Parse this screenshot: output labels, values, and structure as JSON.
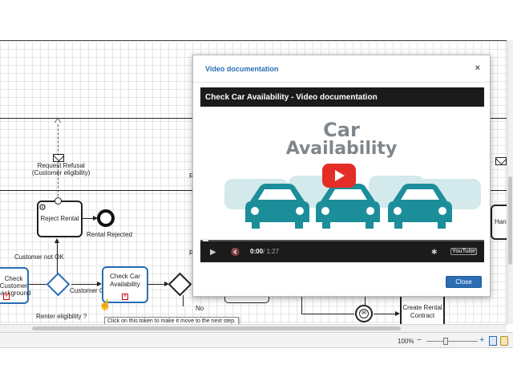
{
  "diagram": {
    "labels": {
      "request_refusal": "Request Refusal\n(Customer eligibility)",
      "reject_rental": "Reject Rental",
      "rental_rejected": "Rental Rejected",
      "customer_not_ok": "Customer not OK",
      "check_customer_background": "Check\nCustomer\nBackground",
      "customer_ok": "Customer OK",
      "check_car_availability": "Check Car\nAvailability",
      "renter_eligibility": "Renter eligibility ?",
      "no": "No",
      "create_rental_contract": "Create Rental\nContract",
      "partial_hand": "Hand",
      "partial_r_top": "R",
      "partial_r_mid": "R"
    },
    "tooltip": "Click on this token to make it move to the next step."
  },
  "modal": {
    "title": "Video documentation",
    "close_x": "×",
    "close_label": "Close",
    "video": {
      "title": "Check Car Availability  - Video documentation",
      "graphic_line1": "Car",
      "graphic_line2": "Availability",
      "time_current": "0:00",
      "time_total": "/ 1:27",
      "logo": "YouTube"
    }
  },
  "statusbar": {
    "zoom": "100%"
  },
  "colors": {
    "accent": "#2a6db5",
    "car_teal": "#1c8e9a",
    "car_faint": "#cfe7ea",
    "yt_red": "#e52d27"
  }
}
